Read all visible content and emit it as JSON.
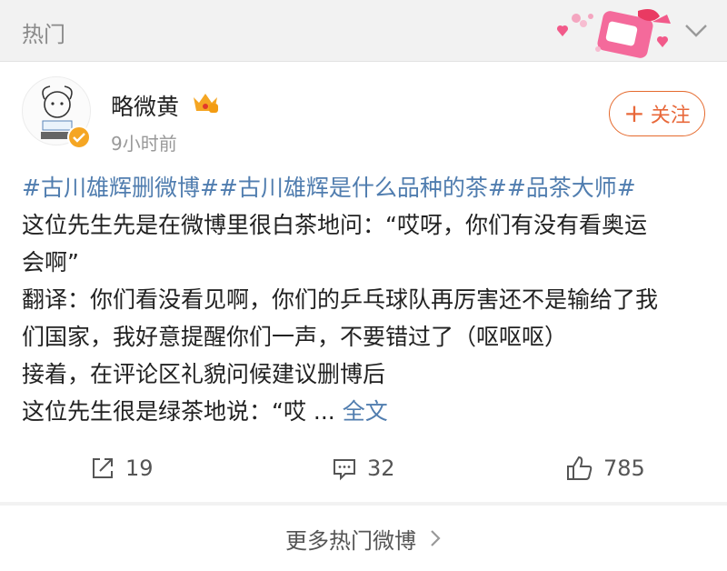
{
  "header": {
    "title": "热门",
    "decoration_icon": "gift-box-decoration-icon",
    "collapse_icon": "chevron-down-icon"
  },
  "post": {
    "username": "略微黄",
    "badge_icon": "crown-badge-icon",
    "verified_icon": "verified-badge-icon",
    "time": "9小时前",
    "follow_label": "关注",
    "follow_icon": "plus-icon",
    "hashtags": [
      "#古川雄辉删微博#",
      "#古川雄辉是什么品种的茶#",
      "#品茶大师#"
    ],
    "lines": [
      "这位先生先是在微博里很白茶地问：“哎呀，你们有没有看奥运",
      "会啊”",
      "翻译：你们看没看见啊，你们的乒乓球队再厉害还不是输给了我",
      "们国家，我好意提醒你们一声，不要错过了（呕呕呕）",
      "接着，在评论区礼貌问候建议删博后",
      "这位先生很是绿茶地说：“哎 ..."
    ],
    "full_text_label": "全文",
    "accent_color": "#507daf"
  },
  "actions": {
    "repost": {
      "icon": "share-icon",
      "count": "19"
    },
    "comment": {
      "icon": "comment-icon",
      "count": "32"
    },
    "like": {
      "icon": "thumbs-up-icon",
      "count": "785"
    }
  },
  "footer": {
    "more_label": "更多热门微博",
    "more_icon": "chevron-right-icon"
  }
}
